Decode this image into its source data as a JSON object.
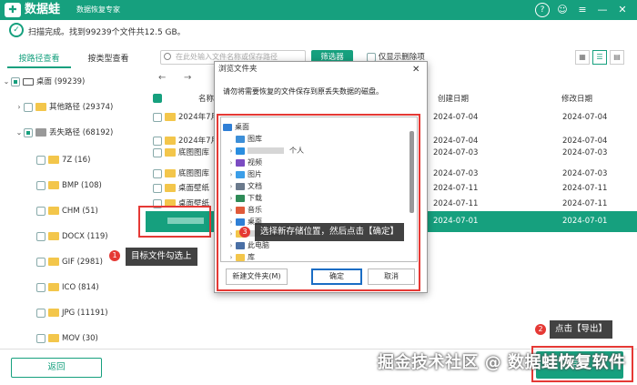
{
  "app": {
    "logo_char": "✚",
    "name": "数据蛙",
    "tagline": "数据恢复专家"
  },
  "header": {
    "help": "?",
    "chat": "☺",
    "menu": "≡",
    "min": "—",
    "close": "✕"
  },
  "status": {
    "text": "扫描完成。找到99239个文件共12.5 GB。"
  },
  "tabs": [
    "按路径查看",
    "按类型查看"
  ],
  "tree": [
    {
      "label": "桌面 (99239)"
    },
    {
      "label": "其他路径 (29374)"
    },
    {
      "label": "丢失路径 (68192)"
    },
    {
      "label": "7Z (16)"
    },
    {
      "label": "BMP (108)"
    },
    {
      "label": "CHM (51)"
    },
    {
      "label": "DOCX (119)"
    },
    {
      "label": "GIF (2981)"
    },
    {
      "label": "ICO (814)"
    },
    {
      "label": "JPG (11191)"
    },
    {
      "label": "MOV (30)"
    }
  ],
  "toolbar": {
    "search_placeholder": "在此处输入文件名称或保存路径",
    "filter": "筛选器",
    "only_deleted": "仅显示删除项"
  },
  "columns": {
    "name": "名称",
    "created": "创建日期",
    "modified": "修改日期"
  },
  "files": [
    {
      "name": "2024年7月",
      "created": "2024-07-04",
      "modified": "2024-07-04"
    },
    {
      "name": "2024年7月",
      "created": "2024-07-04",
      "modified": "2024-07-04"
    },
    {
      "name": "底图图库",
      "created": "2024-07-03",
      "modified": "2024-07-03"
    },
    {
      "name": "底图图库",
      "created": "2024-07-03",
      "modified": "2024-07-03"
    },
    {
      "name": "桌面壁纸",
      "created": "2024-07-11",
      "modified": "2024-07-11"
    },
    {
      "name": "桌面壁纸",
      "created": "2024-07-11",
      "modified": "2024-07-11"
    },
    {
      "name": "",
      "created": "2024-07-01",
      "modified": "2024-07-01"
    }
  ],
  "dialog": {
    "title": "浏览文件夹",
    "message": "请勿将需要恢复的文件保存到原丢失数据的磁盘。",
    "tree": [
      {
        "label": "桌面"
      },
      {
        "label": "图库"
      },
      {
        "label": "个人"
      },
      {
        "label": "视频"
      },
      {
        "label": "图片"
      },
      {
        "label": "文档"
      },
      {
        "label": "下载"
      },
      {
        "label": "音乐"
      },
      {
        "label": "桌面"
      },
      {
        "label": ""
      },
      {
        "label": "此电脑"
      },
      {
        "label": "库"
      }
    ],
    "new_folder": "新建文件夹(M)",
    "ok": "确定",
    "cancel": "取消"
  },
  "callouts": [
    {
      "num": "1",
      "text": "目标文件勾选上"
    },
    {
      "num": "2",
      "text": "点击【导出】"
    },
    {
      "num": "3",
      "text": "选择新存储位置，然后点击【确定】"
    }
  ],
  "footer": {
    "back": "返回",
    "export": "导出"
  },
  "watermark": "掘金技术社区 @ 数据蛙恢复软件",
  "colors": {
    "brand": "#16a07e",
    "callout_red": "#e53935"
  }
}
